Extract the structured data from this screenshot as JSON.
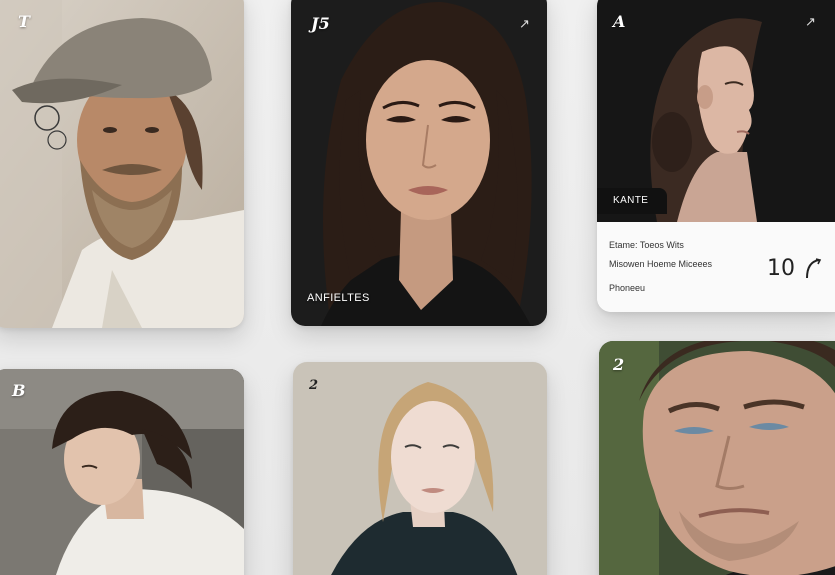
{
  "cards": [
    {
      "id": "card-1",
      "glyph": "T",
      "subject": "bearded man in flat cap"
    },
    {
      "id": "card-2",
      "glyph": "J5",
      "arrow_icon": "arrow-up-right-icon",
      "caption": "ANFIELTES"
    },
    {
      "id": "card-3",
      "glyph": "A",
      "arrow_icon": "arrow-up-right-icon",
      "tag": "KANTE",
      "info": {
        "row1": "Etame: Toeos Wits",
        "row2": "Misowen Hoeme Miceees",
        "row3": "Phoneeu",
        "number": "10"
      }
    },
    {
      "id": "card-4",
      "glyph": "B"
    },
    {
      "id": "card-5",
      "glyph": "2"
    },
    {
      "id": "card-6",
      "glyph": "2"
    }
  ],
  "colors": {
    "background": "#ececec",
    "panel": "#fafafa",
    "dark": "#111111"
  }
}
